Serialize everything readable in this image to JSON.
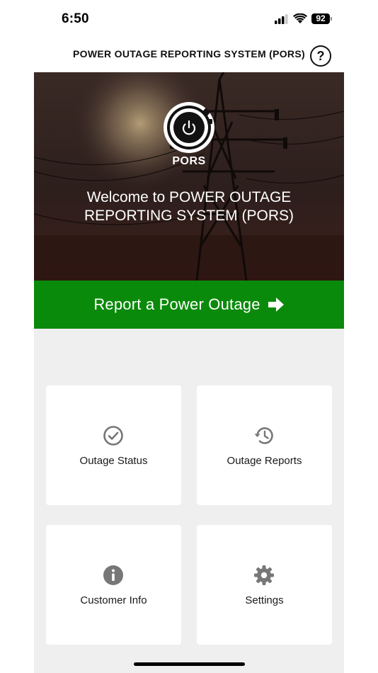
{
  "status_bar": {
    "time": "6:50",
    "battery": "92",
    "icons": [
      "signal-icon",
      "wifi-icon",
      "battery-icon"
    ]
  },
  "header": {
    "title": "POWER OUTAGE REPORTING SYSTEM (PORS)",
    "help_icon": "question-circle-icon",
    "help_glyph": "?"
  },
  "hero": {
    "logo_text": "PORS",
    "welcome": "Welcome to POWER OUTAGE REPORTING SYSTEM (PORS)"
  },
  "report": {
    "label": "Report a Power Outage",
    "icon": "arrow-right-icon"
  },
  "tiles": [
    {
      "label": "Outage Status",
      "icon": "check-circle-icon"
    },
    {
      "label": "Outage Reports",
      "icon": "history-icon"
    },
    {
      "label": "Customer Info",
      "icon": "info-circle-icon"
    },
    {
      "label": "Settings",
      "icon": "gear-icon"
    }
  ],
  "colors": {
    "accent_green": "#0a8a0a",
    "icon_gray": "#777777",
    "grid_background": "#efefef"
  }
}
